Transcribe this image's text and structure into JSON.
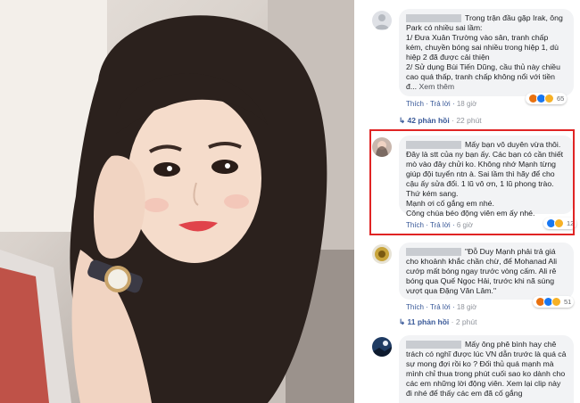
{
  "comments": [
    {
      "text": "Trong trận đầu gặp Irak, ông Park có nhiều sai lầm:\n1/ Đưa Xuân Trường vào sân, tranh chấp kém, chuyền bóng sai nhiều trong hiệp 1, dù hiệp 2 đã được cải thiện\n2/ Sử dụng Bùi Tiến Dũng, cầu thủ này chiều cao quá thấp, tranh chấp không nổi với tiền đ...",
      "see_more": "Xem thêm",
      "like": "Thích",
      "reply": "Trả lời",
      "time": "18 giờ",
      "reaction_count": "65",
      "replies_label": "42 phản hồi",
      "replies_time": "22 phút"
    },
    {
      "text": "Mấy bạn vô duyên vừa thôi. Đây là stt của ny bạn ấy. Các bạn có cần thiết mò vào đây chửi ko. Không nhớ Mạnh từng giúp đội tuyển ntn à. Sai lầm thì hãy để cho cậu ấy sửa đổi. 1 lũ vô ơn, 1 lũ phong trào. Thứ kém sang.\nMạnh ơi cố gắng em nhé.\nCông chúa béo động viên em ấy nhé.",
      "like": "Thích",
      "reply": "Trả lời",
      "time": "6 giờ",
      "reaction_count": "12"
    },
    {
      "text": "\"Đỗ Duy Mạnh phải trả giá cho khoảnh khắc chần chừ, để Mohanad Ali cướp mất bóng ngay trước vòng cấm. Ali rê bóng qua Quế Ngọc Hải, trước khi nã súng vượt qua Đặng Văn Lâm.\"",
      "like": "Thích",
      "reply": "Trả lời",
      "time": "18 giờ",
      "reaction_count": "51",
      "replies_label": "11 phản hồi",
      "replies_time": "2 phút"
    },
    {
      "text": "Mấy ông phê bình hay chê trách có nghĩ được lúc VN dẫn trước là quá cả sự mong đợi rồi ko ? Đối thủ quá mạnh mà mình chỉ thua trong phút cuối sao ko dành cho các em những lời động viên. Xem lại clip này đi nhé để thấy các em đã cố gắng"
    }
  ],
  "colors": {
    "link": "#385898",
    "bubble": "#f2f3f5",
    "highlight": "#e02424",
    "like_blue": "#1877f2",
    "angry_orange": "#e9710f",
    "haha_yellow": "#f7b125"
  },
  "icons": [
    "reply-arrow-icon",
    "like-reaction-icon",
    "haha-reaction-icon",
    "angry-reaction-icon"
  ]
}
